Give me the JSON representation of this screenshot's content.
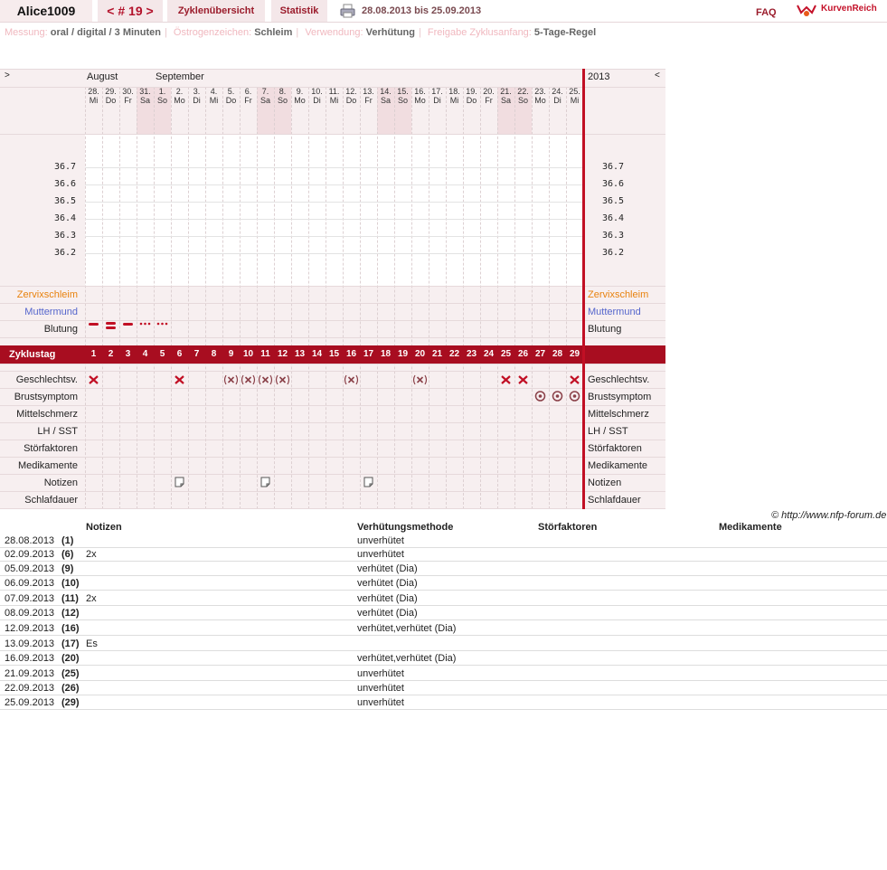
{
  "header": {
    "user": "Alice1009",
    "cycle": "< # 19 >",
    "tab_overview": "Zyklenübersicht",
    "tab_stats": "Statistik",
    "range": "28.08.2013 bis 25.09.2013",
    "faq": "FAQ",
    "logo": "KurvenReich"
  },
  "info": {
    "messung_k": "Messung:",
    "messung_v": "oral / digital / 3 Minuten",
    "oestro_k": "Östrogenzeichen:",
    "oestro_v": "Schleim",
    "verw_k": "Verwendung:",
    "verw_v": "Verhütung",
    "frei_k": "Freigabe Zyklusanfang:",
    "frei_v": "5-Tage-Regel"
  },
  "chart": {
    "nav_left": ">",
    "nav_right": "<",
    "month1": "August",
    "month2": "September",
    "year": "2013",
    "days": [
      [
        "28.",
        "Mi"
      ],
      [
        "29.",
        "Do"
      ],
      [
        "30.",
        "Fr"
      ],
      [
        "31.",
        "Sa"
      ],
      [
        "1.",
        "So"
      ],
      [
        "2.",
        "Mo"
      ],
      [
        "3.",
        "Di"
      ],
      [
        "4.",
        "Mi"
      ],
      [
        "5.",
        "Do"
      ],
      [
        "6.",
        "Fr"
      ],
      [
        "7.",
        "Sa"
      ],
      [
        "8.",
        "So"
      ],
      [
        "9.",
        "Mo"
      ],
      [
        "10.",
        "Di"
      ],
      [
        "11.",
        "Mi"
      ],
      [
        "12.",
        "Do"
      ],
      [
        "13.",
        "Fr"
      ],
      [
        "14.",
        "Sa"
      ],
      [
        "15.",
        "So"
      ],
      [
        "16.",
        "Mo"
      ],
      [
        "17.",
        "Di"
      ],
      [
        "18.",
        "Mi"
      ],
      [
        "19.",
        "Do"
      ],
      [
        "20.",
        "Fr"
      ],
      [
        "21.",
        "Sa"
      ],
      [
        "22.",
        "So"
      ],
      [
        "23.",
        "Mo"
      ],
      [
        "24.",
        "Di"
      ],
      [
        "25.",
        "Mi"
      ]
    ],
    "temps": [
      "36.7",
      "36.6",
      "36.5",
      "36.4",
      "36.3",
      "36.2"
    ],
    "rows": [
      "Zervixschleim",
      "Muttermund",
      "Blutung"
    ],
    "cycle_label": "Zyklustag",
    "cycle_days": [
      "1",
      "2",
      "3",
      "4",
      "5",
      "6",
      "7",
      "8",
      "9",
      "10",
      "11",
      "12",
      "13",
      "14",
      "15",
      "16",
      "17",
      "18",
      "19",
      "20",
      "21",
      "22",
      "23",
      "24",
      "25",
      "26",
      "27",
      "28",
      "29"
    ],
    "rows2": [
      "Geschlechtsv.",
      "Brustsymptom",
      "Mittelschmerz",
      "LH / SST",
      "Störfaktoren",
      "Medikamente",
      "Notizen",
      "Schlafdauer"
    ],
    "colors": {
      "cervix": "#e8820e",
      "mouth": "#5566cc",
      "red": "#c10f24",
      "header_bg": "#f4e7e9"
    }
  },
  "copyright": "© http://www.nfp-forum.de",
  "notes": {
    "headers": [
      "Notizen",
      "Verhütungsmethode",
      "Störfaktoren",
      "Medikamente"
    ],
    "rows": [
      {
        "date": "28.08.2013",
        "day": "(1)",
        "note": "",
        "method": "unverhütet"
      },
      {
        "date": "02.09.2013",
        "day": "(6)",
        "note": "2x",
        "method": "unverhütet"
      },
      {
        "date": "05.09.2013",
        "day": "(9)",
        "note": "",
        "method": "verhütet (Dia)"
      },
      {
        "date": "06.09.2013",
        "day": "(10)",
        "note": "",
        "method": "verhütet (Dia)"
      },
      {
        "date": "07.09.2013",
        "day": "(11)",
        "note": "2x",
        "method": "verhütet (Dia)"
      },
      {
        "date": "08.09.2013",
        "day": "(12)",
        "note": "",
        "method": "verhütet (Dia)"
      },
      {
        "date": "12.09.2013",
        "day": "(16)",
        "note": "",
        "method": "verhütet,verhütet (Dia)"
      },
      {
        "date": "13.09.2013",
        "day": "(17)",
        "note": "Es",
        "method": ""
      },
      {
        "date": "16.09.2013",
        "day": "(20)",
        "note": "",
        "method": "verhütet,verhütet (Dia)"
      },
      {
        "date": "21.09.2013",
        "day": "(25)",
        "note": "",
        "method": "unverhütet"
      },
      {
        "date": "22.09.2013",
        "day": "(26)",
        "note": "",
        "method": "unverhütet"
      },
      {
        "date": "25.09.2013",
        "day": "(29)",
        "note": "",
        "method": "unverhütet"
      }
    ]
  }
}
